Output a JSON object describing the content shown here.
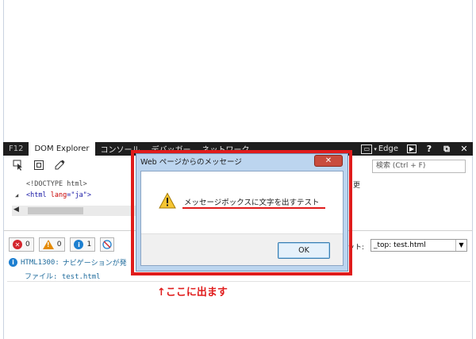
{
  "devtools": {
    "tabs": [
      {
        "label": "F12"
      },
      {
        "label": "DOM Explorer"
      },
      {
        "label": "コンソール"
      },
      {
        "label": "デバッガー"
      },
      {
        "label": "ネットワーク"
      }
    ],
    "emulation_label": "Edge",
    "ctrl_console": "▶",
    "ctrl_help": "?",
    "ctrl_undock": "⧉",
    "ctrl_close": "✕"
  },
  "dom_explorer": {
    "search_placeholder": "検索 (Ctrl + F)",
    "right_pane_label": "更",
    "tree": {
      "doctype": "<!DOCTYPE html>",
      "html_open": "<html",
      "html_attr": "lang",
      "html_eq": "=",
      "html_val": "\"ja\"",
      "html_close": ">"
    }
  },
  "console": {
    "errors_count": "0",
    "warnings_count": "0",
    "info_count": "1",
    "target_label": "ット:",
    "target_value": "_top: test.html",
    "message_code": "HTML1300:",
    "message_text": "ナビゲーションが発",
    "message_file": "ファイル: test.html"
  },
  "dialog": {
    "title": "Web ページからのメッセージ",
    "close_label": "✕",
    "message": "メッセージボックスに文字を出すテスト",
    "ok_label": "OK"
  },
  "annotation": {
    "text": "↑ここに出ます",
    "color": "#e01c1c"
  }
}
